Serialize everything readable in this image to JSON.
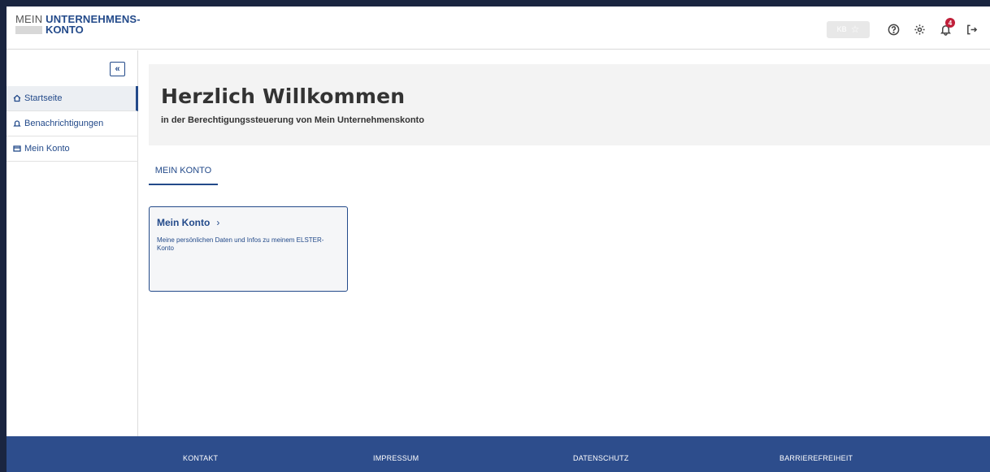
{
  "header": {
    "logo_line1_prefix": "MEIN ",
    "logo_line1_bold": "UNTERNEHMENS-",
    "logo_line2": "KONTO",
    "kb_label": "KB",
    "notification_count": "4",
    "icons": [
      "star-icon",
      "help-icon",
      "gear-icon",
      "bell-icon",
      "logout-icon"
    ]
  },
  "sidebar": {
    "collapse_label": "«",
    "items": [
      {
        "label": "Startseite",
        "icon": "home-icon",
        "active": true
      },
      {
        "label": "Benachrichtigungen",
        "icon": "bell-icon",
        "active": false
      },
      {
        "label": "Mein Konto",
        "icon": "card-icon",
        "active": false
      }
    ]
  },
  "main": {
    "title": "Herzlich Willkommen",
    "subtitle": "in der Berechtigungssteuerung von Mein Unternehmenskonto",
    "tab_label": "MEIN KONTO",
    "card": {
      "title": "Mein Konto",
      "chevron": "›",
      "description": "Meine persönlichen Daten und Infos zu meinem ELSTER-Konto"
    }
  },
  "footer": {
    "links": [
      "KONTAKT",
      "IMPRESSUM",
      "DATENSCHUTZ",
      "BARRIEREFREIHEIT"
    ]
  },
  "colors": {
    "brand": "#234a8a",
    "footer": "#2d4d8c",
    "badge": "#c0203a"
  }
}
